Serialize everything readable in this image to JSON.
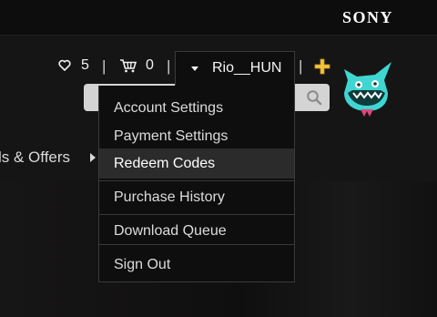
{
  "brand": {
    "logo": "SONY"
  },
  "header": {
    "wishlist": {
      "icon": "heart-icon",
      "count": "5"
    },
    "cart": {
      "icon": "cart-icon",
      "count": "0"
    },
    "separator": "|",
    "user": {
      "name": "Rio__HUN",
      "caret_icon": "caret-down-icon"
    },
    "plus_icon": "ps-plus-icon",
    "search": {
      "placeholder": "",
      "icon": "search-icon"
    },
    "avatar_icon": "avatar-icon"
  },
  "nav": {
    "deals_label": "ls & Offers",
    "arrow_icon": "chevron-right-icon"
  },
  "dropdown": {
    "items": [
      {
        "label": "Account Settings"
      },
      {
        "label": "Payment Settings"
      },
      {
        "label": "Redeem Codes",
        "active": true
      },
      {
        "label": "Purchase History"
      },
      {
        "label": "Download Queue"
      },
      {
        "label": "Sign Out"
      }
    ]
  },
  "colors": {
    "background": "#151414",
    "menu_bg": "#0f0e0e",
    "active_item": "#2c2b2b",
    "plus_gold": "#f5c33b",
    "avatar_teal": "#3fd6d2"
  }
}
